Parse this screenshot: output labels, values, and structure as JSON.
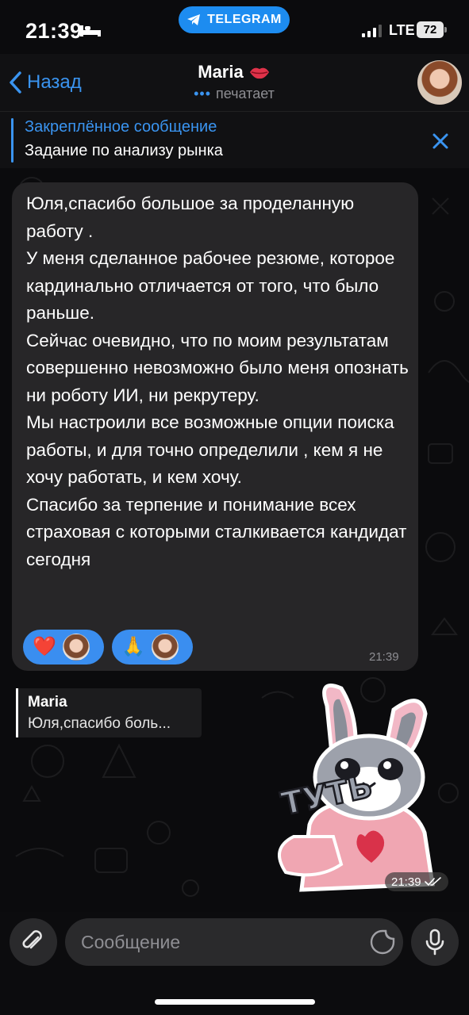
{
  "status_bar": {
    "time": "21:39",
    "app_pill": "TELEGRAM",
    "network": "LTE",
    "battery": "72"
  },
  "header": {
    "back_label": "Назад",
    "name": "Maria",
    "status": "печатает"
  },
  "pinned": {
    "title": "Закреплённое сообщение",
    "text": "Задание по анализу рынка"
  },
  "message_in": {
    "text": "Юля,спасибо большое за проделанную работу .\nУ меня сделанное рабочее резюме, которое кардинально отличается от того, что было раньше.\nСейчас очевидно, что по моим результатам совершенно невозможно было меня опознать ни роботу ИИ, ни рекрутеру.\nМы настроили все возможные опции поиска работы, и для точно определили , кем я не хочу работать,  и кем хочу.\nСпасибо за терпение и понимание всех страховая с которыми сталкивается кандидат сегодня",
    "time": "21:39",
    "reactions": [
      {
        "emoji": "❤️"
      },
      {
        "emoji": "🙏"
      }
    ]
  },
  "reply": {
    "name": "Maria",
    "text": "Юля,спасибо боль..."
  },
  "sticker": {
    "caption": "ТУТЬ",
    "time": "21:39"
  },
  "input": {
    "placeholder": "Сообщение"
  },
  "colors": {
    "accent": "#3a94f0",
    "bubble": "#272628",
    "pill": "#1d8cf0"
  }
}
